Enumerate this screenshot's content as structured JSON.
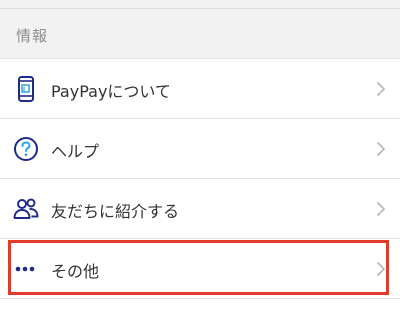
{
  "section": {
    "title": "情報"
  },
  "items": [
    {
      "label": "PayPayについて",
      "icon": "phone-icon"
    },
    {
      "label": "ヘルプ",
      "icon": "help-circle-icon"
    },
    {
      "label": "友だちに紹介する",
      "icon": "people-icon"
    },
    {
      "label": "その他",
      "icon": "more-dots-icon"
    }
  ],
  "colors": {
    "icon_blue": "#1d2a88",
    "highlight": "#e23a2a",
    "chevron": "#b9b9b9",
    "section_bg": "#f2f2f2"
  }
}
